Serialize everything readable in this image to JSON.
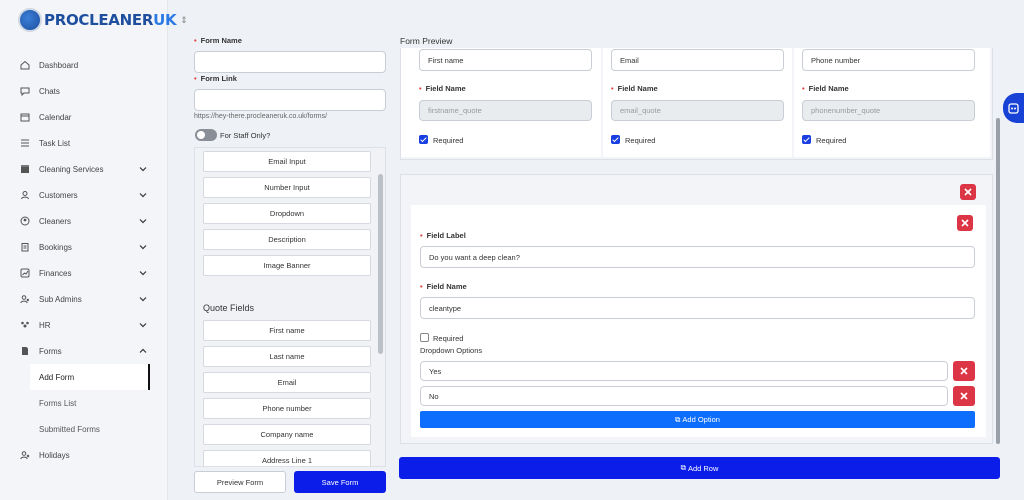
{
  "brand": {
    "name_main": "PROCLEANER",
    "name_accent": "UK"
  },
  "sidebar": {
    "items": [
      {
        "label": "Dashboard",
        "icon": "home-icon"
      },
      {
        "label": "Chats",
        "icon": "chat-icon"
      },
      {
        "label": "Calendar",
        "icon": "calendar-icon"
      },
      {
        "label": "Task List",
        "icon": "list-icon"
      },
      {
        "label": "Cleaning Services",
        "icon": "box-icon",
        "expandable": true
      },
      {
        "label": "Customers",
        "icon": "user-icon",
        "expandable": true
      },
      {
        "label": "Cleaners",
        "icon": "user-badge-icon",
        "expandable": true
      },
      {
        "label": "Bookings",
        "icon": "clipboard-icon",
        "expandable": true
      },
      {
        "label": "Finances",
        "icon": "chart-icon",
        "expandable": true
      },
      {
        "label": "Sub Admins",
        "icon": "users-icon",
        "expandable": true
      },
      {
        "label": "HR",
        "icon": "team-icon",
        "expandable": true
      },
      {
        "label": "Forms",
        "icon": "document-icon",
        "expanded": true
      }
    ],
    "forms_sub": [
      {
        "label": "Add Form",
        "active": true
      },
      {
        "label": "Forms List"
      },
      {
        "label": "Submitted Forms"
      }
    ],
    "after": {
      "label": "Holidays",
      "icon": "holiday-icon"
    }
  },
  "form": {
    "name_label": "Form Name",
    "name_value": "",
    "link_label": "Form Link",
    "link_value": "",
    "link_hint": "https://hey-there.procleaneruk.co.uk/forms/",
    "staff_only_label": "For Staff Only?",
    "staff_only": false
  },
  "palette": {
    "basic_fields": [
      "Email Input",
      "Number Input",
      "Dropdown",
      "Description",
      "Image Banner"
    ],
    "quote_heading": "Quote Fields",
    "quote_fields": [
      "First name",
      "Last name",
      "Email",
      "Phone number",
      "Company name",
      "Address Line 1"
    ]
  },
  "buttons": {
    "preview": "Preview Form",
    "save": "Save Form",
    "add_option": "Add Option",
    "add_row": "Add Row"
  },
  "preview": {
    "title": "Form Preview",
    "row1": [
      {
        "label_value": "First name",
        "field_name_label": "Field Name",
        "field_name_placeholder": "firstname_quote",
        "required_label": "Required",
        "required": true
      },
      {
        "label_value": "Email",
        "field_name_label": "Field Name",
        "field_name_placeholder": "email_quote",
        "required_label": "Required",
        "required": true
      },
      {
        "label_value": "Phone number",
        "field_name_label": "Field Name",
        "field_name_placeholder": "phonenumber_quote",
        "required_label": "Required",
        "required": true
      }
    ],
    "row2": {
      "field_label_label": "Field Label",
      "field_label_value": "Do you want a deep clean?",
      "field_name_label": "Field Name",
      "field_name_value": "cleantype",
      "required_label": "Required",
      "required": false,
      "options_label": "Dropdown Options",
      "options": [
        "Yes",
        "No"
      ]
    }
  },
  "colors": {
    "primary": "#0b1de8",
    "danger": "#dc3545",
    "info": "#0d6efd",
    "required": "#e03d3d"
  }
}
